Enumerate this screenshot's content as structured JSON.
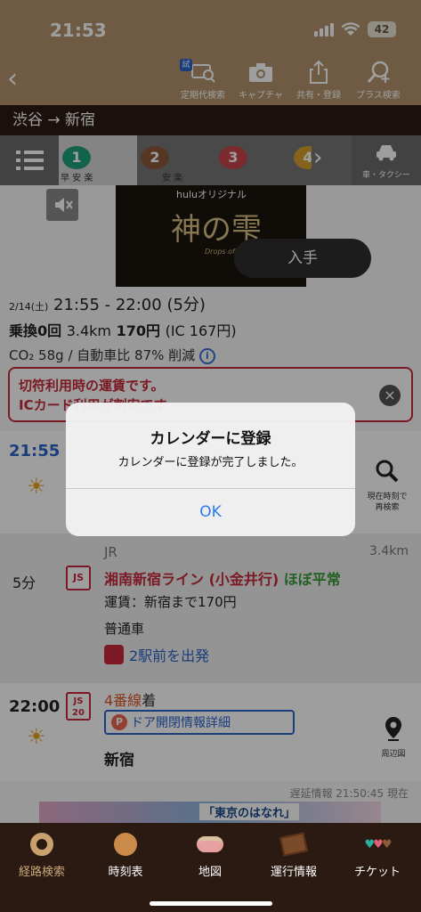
{
  "status": {
    "time": "21:53",
    "battery": "42"
  },
  "toolbar": {
    "trial_badge": "試",
    "items": [
      {
        "label": "定期代検索"
      },
      {
        "label": "キャプチャ"
      },
      {
        "label": "共有・登録"
      },
      {
        "label": "プラス検索"
      }
    ]
  },
  "route": {
    "title": "渋谷 → 新宿"
  },
  "tabs": {
    "routes": [
      {
        "num": "1",
        "tags": "早 安 楽",
        "color": "#1f9e7a"
      },
      {
        "num": "2",
        "tags": "安 楽",
        "color": "#8b5a3a"
      },
      {
        "num": "3",
        "tags": "",
        "color": "#c8454a"
      },
      {
        "num": "4",
        "tags": "",
        "color": "#d9a030"
      }
    ],
    "taxi_label": "車・タクシー"
  },
  "ad": {
    "brand": "huluオリジナル",
    "logo": "神の雫",
    "sub": "Drops of God",
    "cta": "入手"
  },
  "summary": {
    "date": "2/14(土)",
    "times": "21:55 - 22:00 (5分)",
    "transfer": "乗換0回",
    "distance": "3.4km",
    "fare": "170円",
    "ic_fare": "(IC 167円)",
    "co2": "CO₂ 58g / 自動車比 87% 削減",
    "info_icon": "i"
  },
  "notice": {
    "line1": "切符利用時の運賃です。",
    "line2": "ICカード利用が割安です"
  },
  "depart": {
    "time": "21:55",
    "research_label_1": "現在時刻で",
    "research_label_2": "再検索"
  },
  "segment": {
    "duration": "5分",
    "operator": "JR",
    "distance": "3.4km",
    "line": "湘南新宿ライン (小金井行)",
    "status": "ほぼ平常",
    "fare": "運賃：新宿まで170円",
    "type": "普通車",
    "exit": "2駅前を出発",
    "badge": "JS",
    "badge2_top": "JS",
    "badge2_bottom": "20"
  },
  "arrive": {
    "time": "22:00",
    "platform": "4番線",
    "platform_suffix": "着",
    "door_info": "ドア開閉情報詳細",
    "door_icon": "P",
    "station": "新宿",
    "map_label": "周辺図"
  },
  "delay_info": "遅延情報 21:50:45 現在",
  "bottom_ad": {
    "text": "「東京のはなれ」"
  },
  "dialog": {
    "title": "カレンダーに登録",
    "message": "カレンダーに登録が完了しました。",
    "ok": "OK"
  },
  "tabbar": {
    "items": [
      {
        "label": "経路検索"
      },
      {
        "label": "時刻表"
      },
      {
        "label": "地図"
      },
      {
        "label": "運行情報"
      },
      {
        "label": "チケット"
      }
    ]
  }
}
